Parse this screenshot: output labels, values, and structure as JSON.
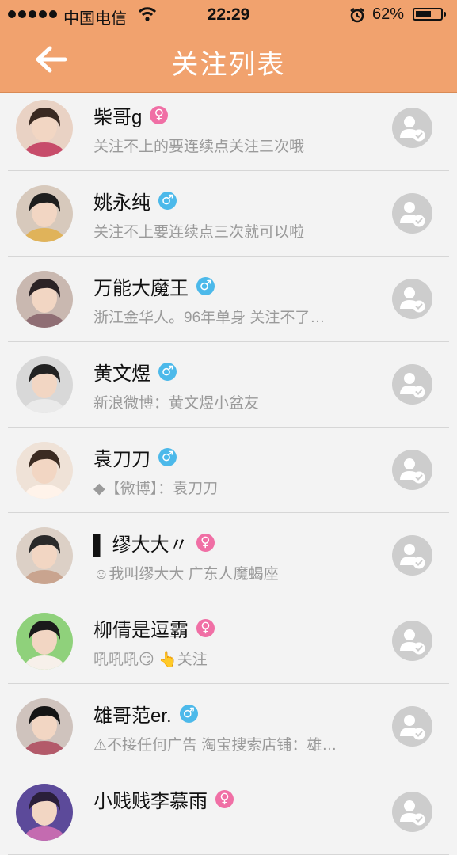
{
  "status_bar": {
    "carrier": "中国电信",
    "time": "22:29",
    "battery": "62%",
    "battery_level": 0.62
  },
  "nav": {
    "title": "关注列表",
    "back_icon": "back-arrow-icon"
  },
  "colors": {
    "header": "#f1a26e",
    "female": "#f06fa5",
    "male": "#4cb9ea",
    "follow": "#cdcdcd"
  },
  "users": [
    {
      "name": "柴哥g",
      "gender": "♀",
      "desc": "关注不上的要连续点关注三次哦"
    },
    {
      "name": "姚永纯",
      "gender": "♂",
      "desc": "关注不上要连续点三次就可以啦"
    },
    {
      "name": "万能大魔王",
      "gender": "♂",
      "desc": "浙江金华人。96年单身 关注不了…"
    },
    {
      "name": "黄文煜",
      "gender": "♂",
      "desc": "新浪微博：黄文煜小盆友"
    },
    {
      "name": "袁刀刀",
      "gender": "♂",
      "desc": "◆【微博】：袁刀刀"
    },
    {
      "name": "▌ 缪大大〃",
      "gender": "♀",
      "desc": "☺我叫缪大大 广东人魔蝎座"
    },
    {
      "name": "柳倩是逗霸",
      "gender": "♀",
      "desc": "吼吼吼😏 👆关注"
    },
    {
      "name": "雄哥范er.",
      "gender": "♂",
      "desc": "⚠不接任何广告 淘宝搜索店铺：雄…"
    },
    {
      "name": "小贱贱李慕雨",
      "gender": "♀",
      "desc": ""
    }
  ]
}
